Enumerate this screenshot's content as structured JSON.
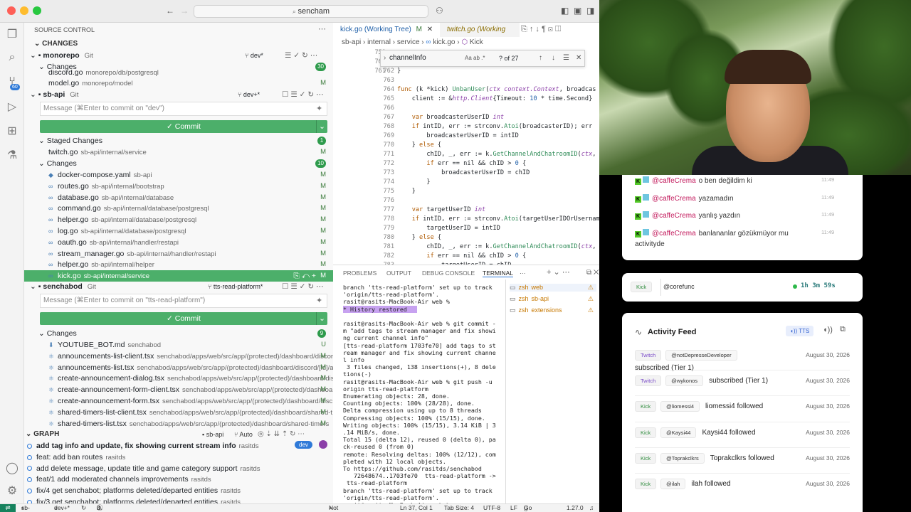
{
  "window": {
    "search": "sencham"
  },
  "sidebar": {
    "title": "SOURCE CONTROL",
    "changes_header": "CHANGES",
    "repos": [
      {
        "name": "monorepo",
        "tag": "Git",
        "branch": "dev*"
      },
      {
        "name": "sb-api",
        "tag": "Git",
        "branch": "dev+*"
      },
      {
        "name": "senchabod",
        "tag": "Git",
        "branch": "tts-read-platform*"
      }
    ],
    "monorepo_changes": {
      "label": "Changes",
      "count": "30"
    },
    "monorepo_files": [
      {
        "name": "discord.go",
        "path": "monorepo/db/postgresql",
        "status": ""
      },
      {
        "name": "model.go",
        "path": "monorepo/model",
        "status": "M"
      }
    ],
    "sbapi_placeholder": "Message (⌘Enter to commit on \"dev\")",
    "commit_label": "✓ Commit",
    "staged": {
      "label": "Staged Changes",
      "count": "1"
    },
    "staged_files": [
      {
        "name": "twitch.go",
        "path": "sb-api/internal/service",
        "status": "M"
      }
    ],
    "sbapi_changes": {
      "label": "Changes",
      "count": "10"
    },
    "sbapi_files": [
      {
        "name": "docker-compose.yaml",
        "path": "sb-api",
        "status": "M"
      },
      {
        "name": "routes.go",
        "path": "sb-api/internal/bootstrap",
        "status": "M"
      },
      {
        "name": "database.go",
        "path": "sb-api/internal/database",
        "status": "M"
      },
      {
        "name": "command.go",
        "path": "sb-api/internal/database/postgresql",
        "status": "M"
      },
      {
        "name": "helper.go",
        "path": "sb-api/internal/database/postgresql",
        "status": "M"
      },
      {
        "name": "log.go",
        "path": "sb-api/internal/database/postgresql",
        "status": "M"
      },
      {
        "name": "oauth.go",
        "path": "sb-api/internal/handler/restapi",
        "status": "M"
      },
      {
        "name": "stream_manager.go",
        "path": "sb-api/internal/handler/restapi",
        "status": "M"
      },
      {
        "name": "helper.go",
        "path": "sb-api/internal/helper",
        "status": "M"
      },
      {
        "name": "kick.go",
        "path": "sb-api/internal/service",
        "status": "M"
      }
    ],
    "sencha_placeholder": "Message (⌘Enter to commit on \"tts-read-platform\")",
    "sencha_changes": {
      "label": "Changes",
      "count": "9"
    },
    "sencha_files": [
      {
        "name": "YOUTUBE_BOT.md",
        "path": "senchabod",
        "status": "U"
      },
      {
        "name": "announcements-list-client.tsx",
        "path": "senchabod/apps/web/src/app/(protected)/dashboard/discor...",
        "status": "M"
      },
      {
        "name": "announcements-list.tsx",
        "path": "senchabod/apps/web/src/app/(protected)/dashboard/discord/[id]/a...",
        "status": "M"
      },
      {
        "name": "create-announcement-dialog.tsx",
        "path": "senchabod/apps/web/src/app/(protected)/dashboard/dis...",
        "status": "M"
      },
      {
        "name": "create-announcement-form-client.tsx",
        "path": "senchabod/apps/web/src/app/(protected)/dashboa...",
        "status": "M"
      },
      {
        "name": "create-announcement-form.tsx",
        "path": "senchabod/apps/web/src/app/(protected)/dashboard/disc...",
        "status": "M"
      },
      {
        "name": "shared-timers-list-client.tsx",
        "path": "senchabod/apps/web/src/app/(protected)/dashboard/shared-t...",
        "status": "M"
      },
      {
        "name": "shared-timers-list.tsx",
        "path": "senchabod/apps/web/src/app/(protected)/dashboard/shared-timers",
        "status": "M"
      }
    ],
    "graph": {
      "title": "GRAPH",
      "repo": "sb-api",
      "mode": "Auto",
      "badge": "dev",
      "commits": [
        {
          "msg": "add tag info and update, fix showing current stream info",
          "author": "rasitds"
        },
        {
          "msg": "feat: add ban routes",
          "author": "rasitds"
        },
        {
          "msg": "add delete message, update title and game category support",
          "author": "rasitds"
        },
        {
          "msg": "feat/1 add moderated channels improvements",
          "author": "rasitds"
        },
        {
          "msg": "fix/4 get senchabot; platforms deleted/departed entities",
          "author": "rasitds"
        },
        {
          "msg": "fix/3 get senchabot; platforms deleted/departed entities",
          "author": "rasitds"
        }
      ]
    }
  },
  "editor": {
    "tabs": [
      {
        "label": "kick.go (Working Tree)",
        "flag": "M"
      },
      {
        "label": "twitch.go (Working"
      }
    ],
    "breadcrumb": [
      "sb-api",
      "internal",
      "service",
      "kick.go",
      "Kick"
    ],
    "find": {
      "query": "channelInfo",
      "result": "? of 27"
    },
    "top_lines": [
      "759",
      "760",
      "761"
    ],
    "lines": [
      {
        "n": "762",
        "t": "}"
      },
      {
        "n": "763",
        "t": ""
      },
      {
        "n": "764",
        "t": "func (k *kick) UnbanUser(ctx context.Context, broadcas"
      },
      {
        "n": "765",
        "t": "    client := &http.Client{Timeout: 10 * time.Second}"
      },
      {
        "n": "766",
        "t": ""
      },
      {
        "n": "767",
        "t": "    var broadcasterUserID int"
      },
      {
        "n": "768",
        "t": "    if intID, err := strconv.Atoi(broadcasterID); err"
      },
      {
        "n": "769",
        "t": "        broadcasterUserID = intID"
      },
      {
        "n": "770",
        "t": "    } else {"
      },
      {
        "n": "771",
        "t": "        chID, _, err := k.GetChannelAndChatroomID(ctx,"
      },
      {
        "n": "772",
        "t": "        if err == nil && chID > 0 {"
      },
      {
        "n": "773",
        "t": "            broadcasterUserID = chID"
      },
      {
        "n": "774",
        "t": "        }"
      },
      {
        "n": "775",
        "t": "    }"
      },
      {
        "n": "776",
        "t": ""
      },
      {
        "n": "777",
        "t": "    var targetUserID int"
      },
      {
        "n": "778",
        "t": "    if intID, err := strconv.Atoi(targetUserIDOrUsernam"
      },
      {
        "n": "779",
        "t": "        targetUserID = intID"
      },
      {
        "n": "780",
        "t": "    } else {"
      },
      {
        "n": "781",
        "t": "        chID, _, err := k.GetChannelAndChatroomID(ctx,"
      },
      {
        "n": "782",
        "t": "        if err == nil && chID > 0 {"
      },
      {
        "n": "783",
        "t": "            targetUserID = chID"
      }
    ]
  },
  "panel": {
    "tabs": [
      "PROBLEMS",
      "OUTPUT",
      "DEBUG CONSOLE",
      "TERMINAL"
    ],
    "terminals": [
      {
        "label": "zsh",
        "sub": "web"
      },
      {
        "label": "zsh",
        "sub": "sb-api"
      },
      {
        "label": "zsh",
        "sub": "extensions"
      }
    ],
    "lines": [
      "branch 'tts-read-platform' set up to track",
      "'origin/tts-read-platform'.",
      "rasit@rasits-MacBook-Air web %",
      "* History restored",
      "",
      "rasit@rasits-MacBook-Air web % git commit -",
      "m \"add tags to stream manager and fix showi",
      "ng current channel info\"",
      "[tts-read-platform 1703fe70] add tags to st",
      "ream manager and fix showing current channe",
      "l info",
      " 3 files changed, 138 insertions(+), 8 dele",
      "tions(-)",
      "rasit@rasits-MacBook-Air web % git push -u",
      "origin tts-read-platform",
      "Enumerating objects: 28, done.",
      "Counting objects: 100% (28/28), done.",
      "Delta compression using up to 8 threads",
      "Compressing objects: 100% (15/15), done.",
      "Writing objects: 100% (15/15), 3.14 KiB | 3",
      ".14 MiB/s, done.",
      "Total 15 (delta 12), reused 0 (delta 0), pa",
      "ck-reused 0 (from 0)",
      "remote: Resolving deltas: 100% (12/12), com",
      "pleted with 12 local objects.",
      "To https://github.com/rasitds/senchabod",
      "   72648674..1703fe70  tts-read-platform ->",
      " tts-read-platform",
      "branch 'tts-read-platform' set up to track",
      "'origin/tts-read-platform'.",
      "rasit@rasits-MacBook-Air web % "
    ]
  },
  "statusbar": {
    "branch": "sb-api",
    "branch2": "dev+*",
    "errors": "0",
    "warnings": "0",
    "commit": "Not Committed Yet",
    "position": "Ln 37, Col 1",
    "tabsize": "Tab Size: 4",
    "encoding": "UTF-8",
    "eol": "LF",
    "lang": "Go",
    "version": "1.27.0"
  },
  "chat": [
    {
      "user": "@caffeCrema",
      "text": "o ben değildim ki",
      "time": "11:49"
    },
    {
      "user": "@caffeCrema",
      "text": "yazamadın",
      "time": "11:49"
    },
    {
      "user": "@caffeCrema",
      "text": "yanlış yazdın",
      "time": "11:49"
    },
    {
      "user": "@caffeCrema",
      "text": "banlananlar gözükmüyor mu",
      "time": "11:49"
    }
  ],
  "chat_wrap": "activityde",
  "kickbar": {
    "platform": "Kick",
    "user": "@corefunc",
    "uptime": "1h 3m 59s"
  },
  "feed": {
    "title": "Activity Feed",
    "tts": "TTS",
    "items": [
      {
        "platform": "Twitch",
        "user": "@notDepresseDeveloper",
        "text": "subscribed (Tier 1)",
        "date": "August 30, 2026"
      },
      {
        "platform": "Twitch",
        "user": "@wykonos",
        "text": "subscribed (Tier 1)",
        "date": "August 30, 2026"
      },
      {
        "platform": "Kick",
        "user": "@liomessi4",
        "text": "liomessi4 followed",
        "date": "August 30, 2026"
      },
      {
        "platform": "Kick",
        "user": "@Kaysi44",
        "text": "Kaysi44 followed",
        "date": "August 30, 2026"
      },
      {
        "platform": "Kick",
        "user": "@Toprakclkrs",
        "text": "Toprakclkrs followed",
        "date": "August 30, 2026"
      },
      {
        "platform": "Kick",
        "user": "@ilah",
        "text": "ilah followed",
        "date": "August 30, 2026"
      }
    ]
  }
}
